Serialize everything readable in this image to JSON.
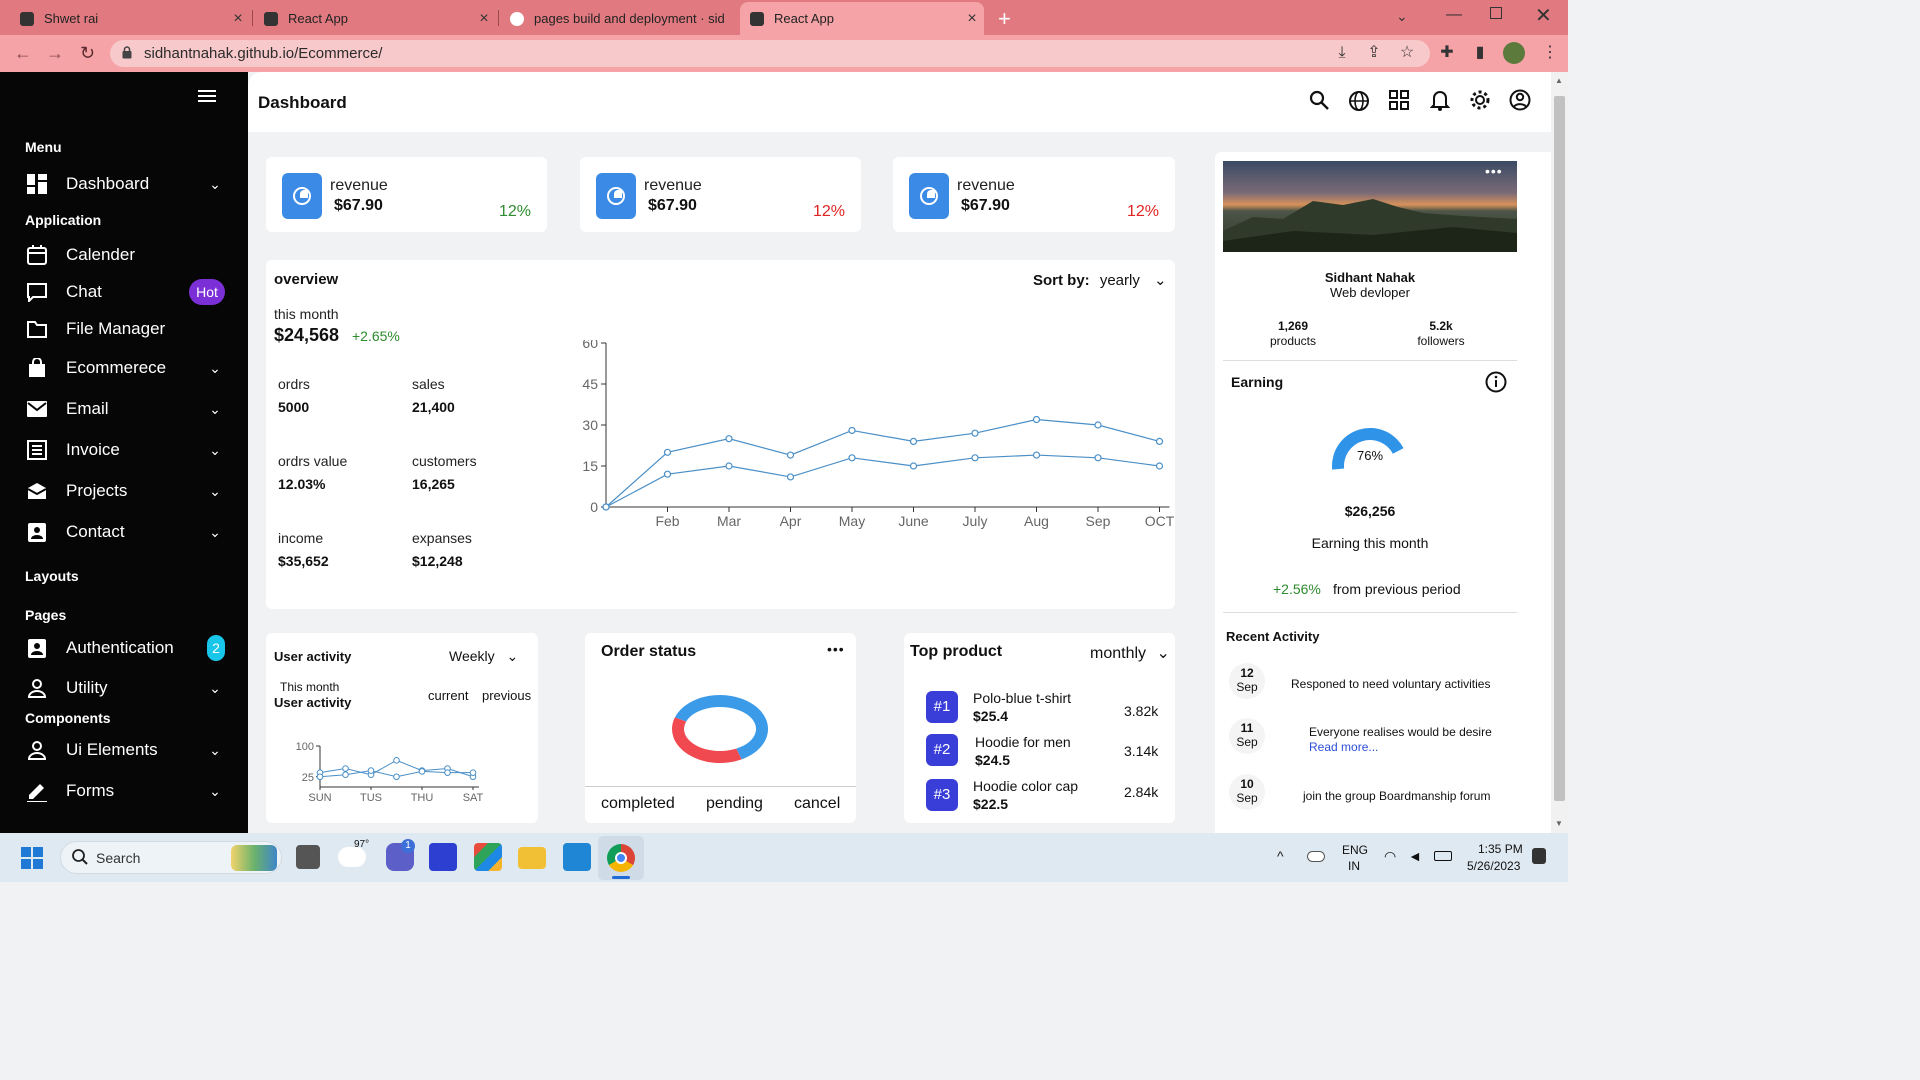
{
  "browser": {
    "tabs": [
      {
        "title": "Shwet rai",
        "active": false
      },
      {
        "title": "React App",
        "active": false
      },
      {
        "title": "pages build and deployment · sid",
        "active": false
      },
      {
        "title": "React App",
        "active": true
      }
    ],
    "url": "sidhantnahak.github.io/Ecommerce/"
  },
  "sidebar": {
    "menu_heading": "Menu",
    "application_heading": "Application",
    "layouts_heading": "Layouts",
    "pages_heading": "Pages",
    "components_heading": "Components",
    "items": {
      "dashboard": "Dashboard",
      "calender": "Calender",
      "chat": "Chat",
      "chat_badge": "Hot",
      "file_manager": "File Manager",
      "ecommerce": "Ecommerece",
      "email": "Email",
      "invoice": "Invoice",
      "projects": "Projects",
      "contact": "Contact",
      "authentication": "Authentication",
      "auth_badge": "2",
      "utility": "Utility",
      "ui_elements": "Ui Elements",
      "forms": "Forms"
    }
  },
  "header": {
    "title": "Dashboard"
  },
  "revenue_cards": [
    {
      "label": "revenue",
      "value": "$67.90",
      "pct": "12%",
      "pct_color": "#2e8b2e"
    },
    {
      "label": "revenue",
      "value": "$67.90",
      "pct": "12%",
      "pct_color": "#e02424"
    },
    {
      "label": "revenue",
      "value": "$67.90",
      "pct": "12%",
      "pct_color": "#e02424"
    }
  ],
  "overview": {
    "title": "overview",
    "sort_label": "Sort by:",
    "sort_value": "yearly",
    "this_month_label": "this month",
    "this_month_value": "$24,568",
    "this_month_change": "+2.65%",
    "stats": [
      {
        "label": "ordrs",
        "value": "5000"
      },
      {
        "label": "sales",
        "value": "21,400"
      },
      {
        "label": "ordrs value",
        "value": "12.03%"
      },
      {
        "label": "customers",
        "value": "16,265"
      },
      {
        "label": "income",
        "value": "$35,652"
      },
      {
        "label": "expanses",
        "value": "$12,248"
      }
    ]
  },
  "chart_data": [
    {
      "type": "line",
      "categories": [
        "",
        "Feb",
        "Mar",
        "Apr",
        "May",
        "June",
        "July",
        "Aug",
        "Sep",
        "OCT"
      ],
      "series": [
        {
          "values": [
            0,
            20,
            25,
            19,
            28,
            24,
            27,
            32,
            30,
            24
          ]
        },
        {
          "values": [
            0,
            12,
            15,
            11,
            18,
            15,
            18,
            19,
            18,
            15
          ]
        }
      ],
      "yticks": [
        0,
        15,
        30,
        45,
        60
      ],
      "ylim": [
        0,
        60
      ],
      "grid": false,
      "color": "#4a8fc7"
    },
    {
      "type": "line",
      "categories": [
        "SUN",
        "TUS",
        "THU",
        "SAT"
      ],
      "series": [
        {
          "values": [
            35,
            45,
            30,
            65,
            40,
            45,
            25
          ]
        },
        {
          "values": [
            25,
            30,
            40,
            25,
            38,
            35,
            35
          ]
        }
      ],
      "yticks": [
        25,
        100
      ],
      "ylim": [
        0,
        100
      ],
      "color": "#4a8fc7"
    },
    {
      "type": "pie",
      "categories": [
        "completed",
        "pending",
        "cancel"
      ],
      "values": [
        0,
        62,
        38
      ],
      "colors": [
        "#cccccc",
        "#3b9be8",
        "#f04a50"
      ]
    }
  ],
  "user_activity": {
    "title": "User activity",
    "period": "Weekly",
    "this_month": "This month",
    "sub": "User activity",
    "current": "current",
    "previous": "previous"
  },
  "order_status": {
    "title": "Order status",
    "menu": "•••",
    "legend": [
      "completed",
      "pending",
      "cancel"
    ]
  },
  "top_product": {
    "title": "Top product",
    "period": "monthly",
    "items": [
      {
        "rank": "#1",
        "name": "Polo-blue t-shirt",
        "price": "$25.4",
        "count": "3.82k"
      },
      {
        "rank": "#2",
        "name": "Hoodie for men",
        "price": "$24.5",
        "count": "3.14k"
      },
      {
        "rank": "#3",
        "name": "Hoodie color cap",
        "price": "$22.5",
        "count": "2.84k"
      }
    ]
  },
  "profile": {
    "menu": "•••",
    "name": "Sidhant Nahak",
    "role": "Web devloper",
    "products_count": "1,269",
    "products_label": "products",
    "followers_count": "5.2k",
    "followers_label": "followers"
  },
  "earning": {
    "title": "Earning",
    "gauge_value": 76,
    "gauge_label": "76%",
    "amount": "$26,256",
    "caption": "Earning this month",
    "change": "+2.56%",
    "change_caption": "from previous period"
  },
  "recent_activity": {
    "title": "Recent Activity",
    "items": [
      {
        "day": "12",
        "month": "Sep",
        "text": "Responed to need voluntary activities",
        "link": ""
      },
      {
        "day": "11",
        "month": "Sep",
        "text": "Everyone realises would be desire",
        "link": "Read more..."
      },
      {
        "day": "10",
        "month": "Sep",
        "text": "join the group Boardmanship forum",
        "link": ""
      }
    ]
  },
  "taskbar": {
    "search": "Search",
    "weather": "97°",
    "chat_badge": "1",
    "lang_1": "ENG",
    "lang_2": "IN",
    "time": "1:35 PM",
    "date": "5/26/2023"
  }
}
